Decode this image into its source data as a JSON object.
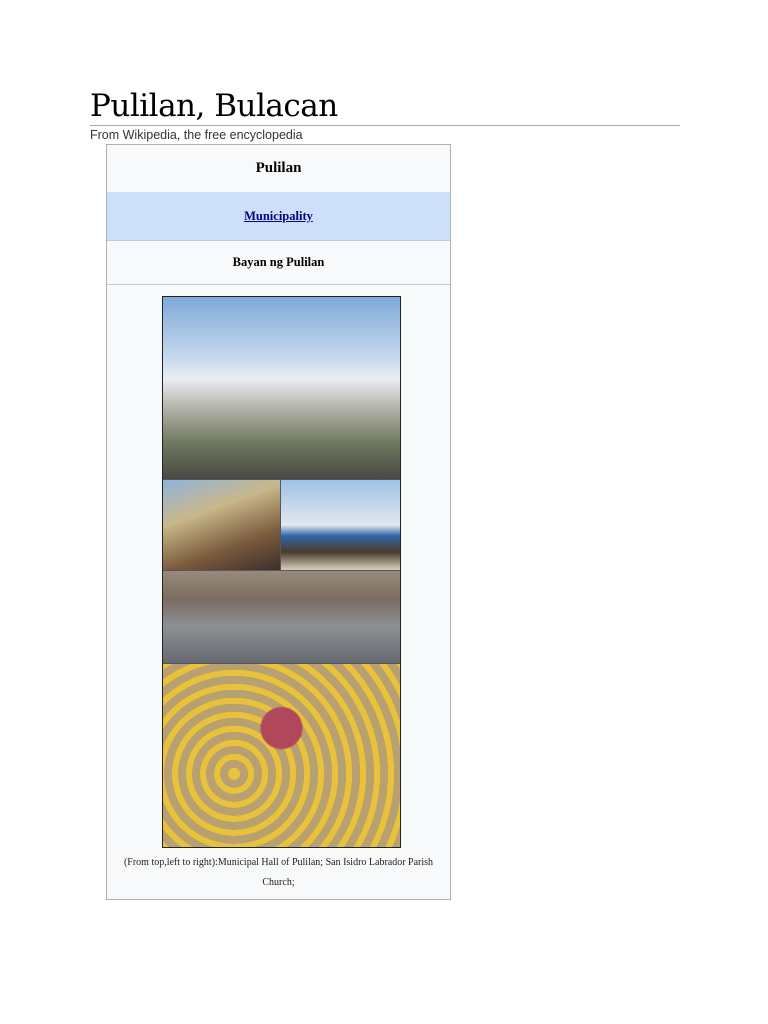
{
  "page": {
    "title": "Pulilan, Bulacan",
    "tagline": "From Wikipedia, the free encyclopedia"
  },
  "infobox": {
    "name": "Pulilan",
    "type_link": "Municipality",
    "native_name": "Bayan ng Pulilan",
    "caption": "(From top,left to right):Municipal Hall of Pulilan; San Isidro Labrador Parish Church;",
    "header_color": "#cedff9"
  }
}
